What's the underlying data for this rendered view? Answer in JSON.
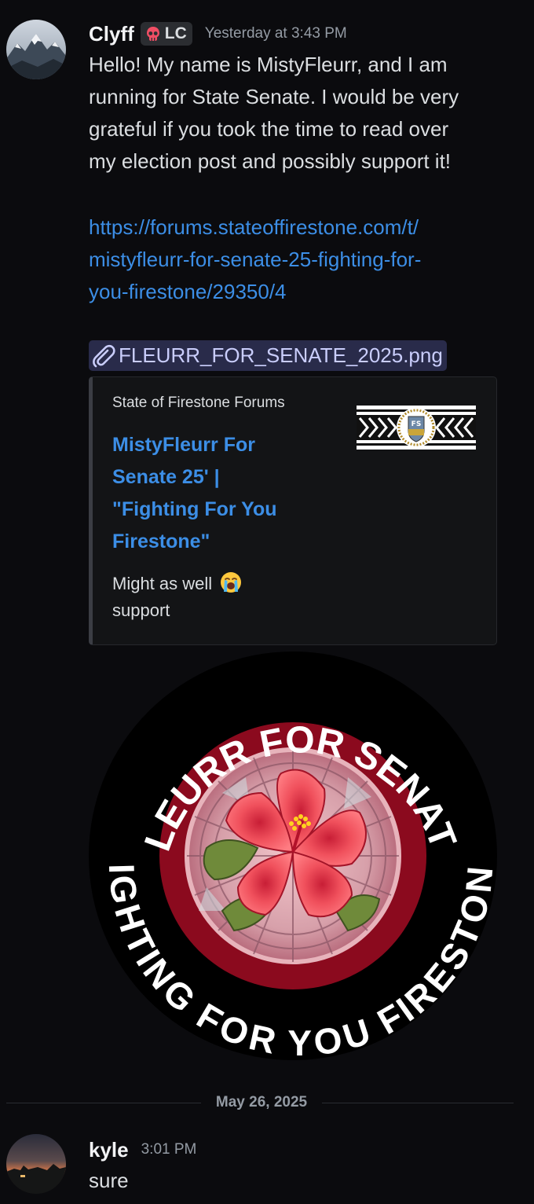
{
  "message1": {
    "username": "Clyff",
    "tag_icon": "skull-icon",
    "tag_text": "LC",
    "timestamp": "Yesterday at 3:43 PM",
    "body_lines": [
      "Hello! My name is MistyFleurr, and I am",
      "running for State Senate. I would be very",
      "grateful if you took the time to read over",
      "my election post and possibly support it!"
    ],
    "link_lines": [
      "https://forums.stateoffirestone.com/t/",
      "mistyfleurr-for-senate-25-fighting-for-",
      "you-firestone/29350/4"
    ],
    "attachment": {
      "icon": "paperclip-icon",
      "filename": "FLEURR_FOR_SENATE_2025.png"
    },
    "embed": {
      "provider": "State of Firestone Forums",
      "title_lines": [
        "MistyFleurr For",
        "Senate 25' |",
        "\"Fighting For You",
        "Firestone\""
      ],
      "description_line1": "Might as well",
      "description_emoji": "loudly-crying-face-emoji",
      "description_line2": "support",
      "thumbnail_monogram": "FS"
    },
    "poster": {
      "top_text": "FLEURR FOR SENATE",
      "bottom_text": "FIGHTING FOR YOU FIRESTONE",
      "colors": {
        "ring": "#000000",
        "inner": "#8b0a1e",
        "flower": "#e8404a"
      }
    }
  },
  "date_divider": "May 26, 2025",
  "message2": {
    "username": "kyle",
    "timestamp": "3:01 PM",
    "body": "sure"
  },
  "colors": {
    "background": "#0b0b0e",
    "link": "#3c8ee6",
    "muted": "#949ba4"
  }
}
